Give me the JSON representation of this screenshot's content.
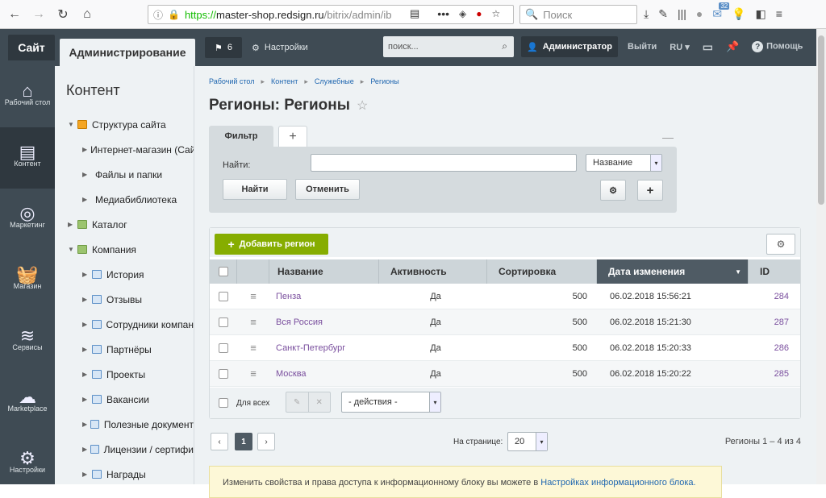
{
  "browser": {
    "url_protocol": "https://",
    "url_host": "master-shop.redsign.ru",
    "url_path": "/bitrix/admin/ib",
    "search_placeholder": "Поиск",
    "badge_count": "32"
  },
  "topnav": {
    "site_tab": "Сайт",
    "admin_tab": "Администрирование",
    "notifications_count": "6",
    "settings_label": "Настройки",
    "search_placeholder": "поиск...",
    "user_label": "Администратор",
    "logout_label": "Выйти",
    "lang_label": "RU",
    "help_label": "Помощь"
  },
  "leftbar": {
    "items": [
      {
        "label": "Рабочий стол",
        "icon": "home-icon"
      },
      {
        "label": "Контент",
        "icon": "document-icon"
      },
      {
        "label": "Маркетинг",
        "icon": "target-icon"
      },
      {
        "label": "Магазин",
        "icon": "basket-icon"
      },
      {
        "label": "Сервисы",
        "icon": "layers-icon"
      },
      {
        "label": "Marketplace",
        "icon": "cloud-download-icon"
      },
      {
        "label": "Настройки",
        "icon": "gear-icon"
      }
    ]
  },
  "menu": {
    "title": "Контент",
    "items": [
      {
        "label": "Структура сайта",
        "level": 0,
        "open": true,
        "icon": "struct"
      },
      {
        "label": "Интернет-магазин (Сайт",
        "level": 1
      },
      {
        "label": "Файлы и папки",
        "level": 1
      },
      {
        "label": "Медиабиблиотека",
        "level": 1
      },
      {
        "label": "Каталог",
        "level": 0,
        "icon": "green"
      },
      {
        "label": "Компания",
        "level": 0,
        "open": true,
        "icon": "green"
      },
      {
        "label": "История",
        "level": 1,
        "icon": "blue"
      },
      {
        "label": "Отзывы",
        "level": 1,
        "icon": "blue"
      },
      {
        "label": "Сотрудники компан",
        "level": 1,
        "icon": "blue"
      },
      {
        "label": "Партнёры",
        "level": 1,
        "icon": "blue"
      },
      {
        "label": "Проекты",
        "level": 1,
        "icon": "blue"
      },
      {
        "label": "Вакансии",
        "level": 1,
        "icon": "blue"
      },
      {
        "label": "Полезные документ",
        "level": 1,
        "icon": "blue"
      },
      {
        "label": "Лицензии / сертифи",
        "level": 1,
        "icon": "blue"
      },
      {
        "label": "Награды",
        "level": 1,
        "icon": "blue"
      }
    ]
  },
  "breadcrumbs": [
    "Рабочий стол",
    "Контент",
    "Служебные",
    "Регионы"
  ],
  "page_title": "Регионы: Регионы",
  "filter": {
    "tab_label": "Фильтр",
    "find_label": "Найти:",
    "find_value": "",
    "field_select": "Название",
    "find_button": "Найти",
    "cancel_button": "Отменить"
  },
  "grid": {
    "add_button": "Добавить регион",
    "columns": [
      "Название",
      "Активность",
      "Сортировка",
      "Дата изменения",
      "ID"
    ],
    "rows": [
      {
        "name": "Пенза",
        "active": "Да",
        "sort": "500",
        "date": "06.02.2018 15:56:21",
        "id": "284"
      },
      {
        "name": "Вся Россия",
        "active": "Да",
        "sort": "500",
        "date": "06.02.2018 15:21:30",
        "id": "287"
      },
      {
        "name": "Санкт-Петербург",
        "active": "Да",
        "sort": "500",
        "date": "06.02.2018 15:20:33",
        "id": "286"
      },
      {
        "name": "Москва",
        "active": "Да",
        "sort": "500",
        "date": "06.02.2018 15:20:22",
        "id": "285"
      }
    ],
    "for_all_label": "Для всех",
    "actions_select": "- действия -"
  },
  "pager": {
    "current_page": "1",
    "per_page_label": "На странице:",
    "per_page_value": "20",
    "summary": "Регионы 1 – 4 из 4"
  },
  "notice": {
    "text": "Изменить свойства и права доступа к информационному блоку вы можете в ",
    "link": "Настройках информационного блока."
  },
  "colors": {
    "nav_bg": "#3f4b54",
    "accent_green": "#86ad00",
    "link": "#2067b0",
    "row_link": "#7a4f9e"
  }
}
